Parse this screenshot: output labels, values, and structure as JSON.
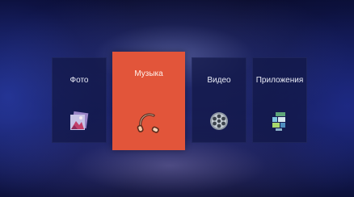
{
  "menu": {
    "items": [
      {
        "label": "Фото",
        "icon": "photo-icon",
        "selected": false
      },
      {
        "label": "Музыка",
        "icon": "headphones-icon",
        "selected": true
      },
      {
        "label": "Видео",
        "icon": "film-reel-icon",
        "selected": false
      },
      {
        "label": "Приложения",
        "icon": "apps-icon",
        "selected": false
      }
    ]
  },
  "colors": {
    "selected_tile": "#e2553a",
    "tile": "#121846",
    "background": "#1a2160",
    "text": "#e9ebf6"
  }
}
